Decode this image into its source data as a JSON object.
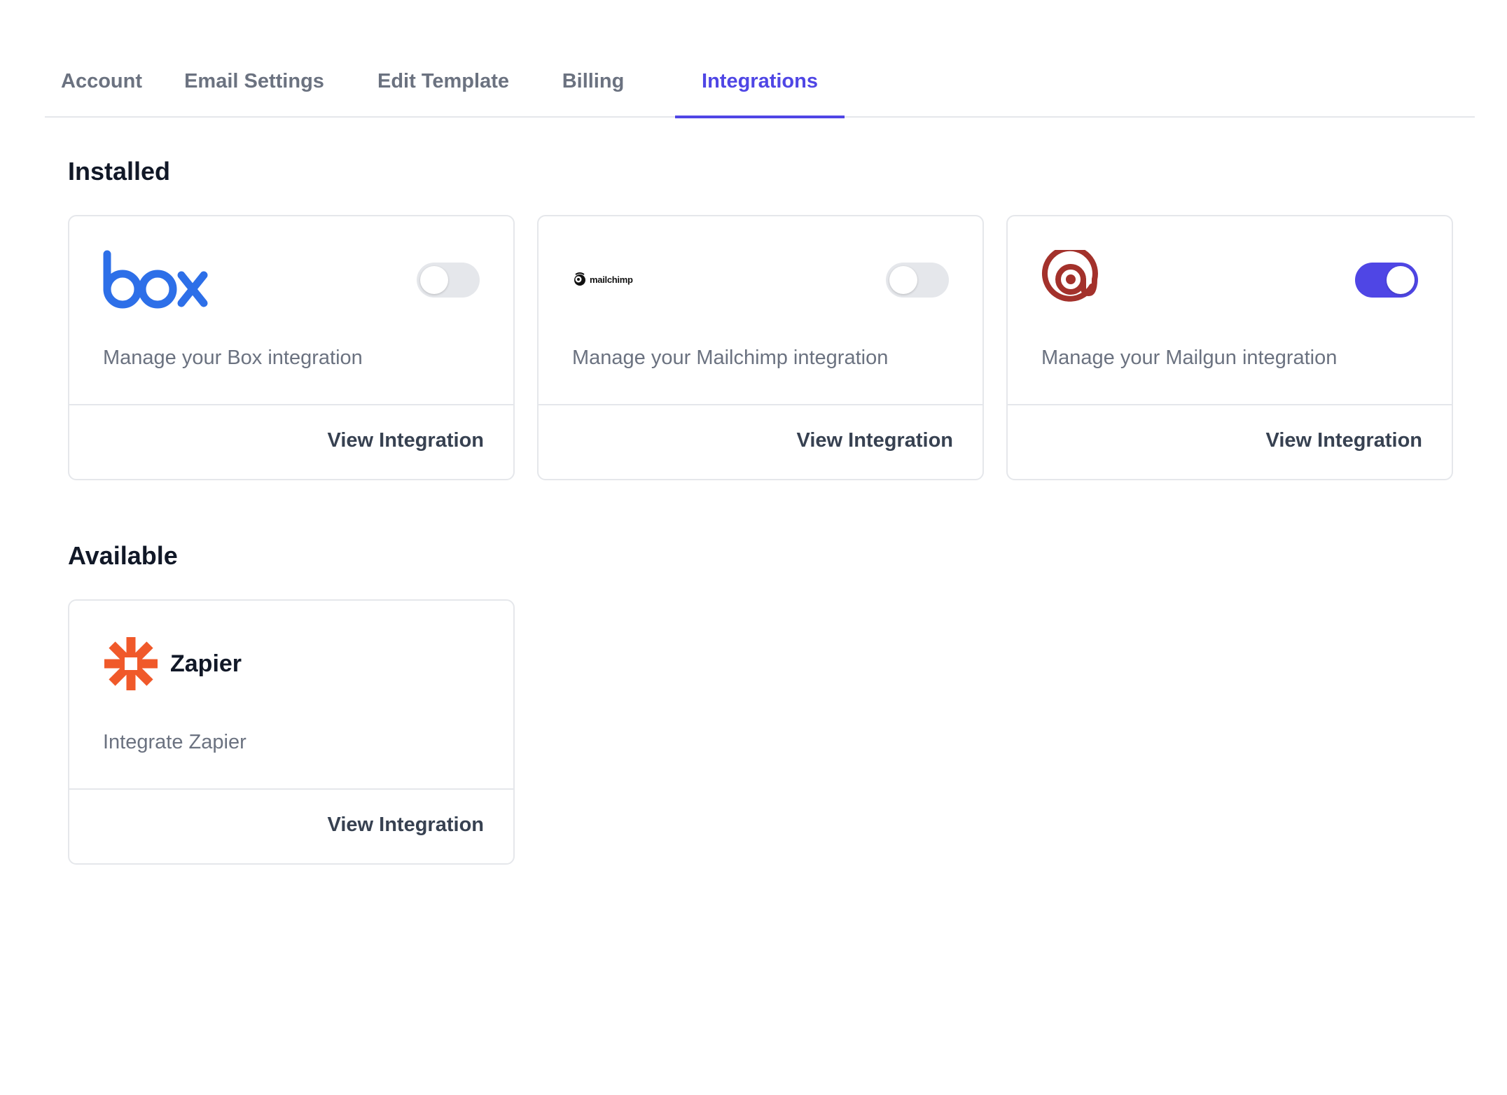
{
  "tabs": [
    {
      "label": "Account",
      "active": false
    },
    {
      "label": "Email Settings",
      "active": false
    },
    {
      "label": "Edit Template",
      "active": false
    },
    {
      "label": "Billing",
      "active": false
    },
    {
      "label": "Integrations",
      "active": true
    }
  ],
  "installed": {
    "title": "Installed",
    "cards": [
      {
        "logo": "box-logo",
        "description": "Manage your Box integration",
        "enabled": false,
        "action": "View Integration"
      },
      {
        "logo": "mailchimp-logo",
        "logo_text": "mailchimp",
        "description": "Manage your Mailchimp integration",
        "enabled": false,
        "action": "View Integration"
      },
      {
        "logo": "mailgun-logo",
        "description": "Manage your Mailgun integration",
        "enabled": true,
        "action": "View Integration"
      }
    ]
  },
  "available": {
    "title": "Available",
    "cards": [
      {
        "logo": "zapier-logo",
        "name": "Zapier",
        "description": "Integrate Zapier",
        "action": "View Integration"
      }
    ]
  },
  "colors": {
    "accent": "#4f46e5",
    "box_blue": "#2d6fe8",
    "mailgun_red": "#a3312b",
    "zapier_orange": "#f0592a"
  }
}
